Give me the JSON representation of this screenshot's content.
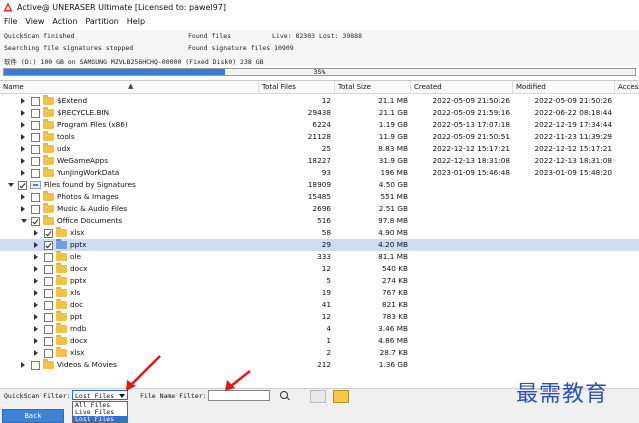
{
  "window": {
    "title": "Active@ UNERASER Ultimate [Licensed to: pawel97]"
  },
  "menu": [
    "File",
    "View",
    "Action",
    "Partition",
    "Help"
  ],
  "status": {
    "line1": "QuickScan finished",
    "line2": "Searching file signatures stopped",
    "line3": "Found files",
    "line4": "Found signature files  10909",
    "line5": "Live: 82303 Lost: 39888",
    "line6": "软件 (D:) 100 GB on SAMSUNG MZVLB256HCHQ-00000 (Fixed Disk0) 238 GB"
  },
  "progress": {
    "value": 35,
    "label": "35%"
  },
  "columns": {
    "name": "Name",
    "total_files": "Total Files",
    "total_size": "Total Size",
    "created": "Created",
    "modified": "Modified",
    "accessed": "Access"
  },
  "rows": [
    {
      "name": "$Extend",
      "files": "12",
      "size": "21.1 MB",
      "created": "2022-05-09 21:50:26",
      "modified": "2022-05-09 21:50:26"
    },
    {
      "name": "$RECYCLE.BIN",
      "files": "29438",
      "size": "21.1 GB",
      "created": "2022-05-09 21:59:16",
      "modified": "2022-06-22 08:18:44"
    },
    {
      "name": "Program Files (x86)",
      "files": "6224",
      "size": "1.19 GB",
      "created": "2022-05-13 17:07:18",
      "modified": "2022-12-19 17:34:44"
    },
    {
      "name": "tools",
      "files": "21128",
      "size": "11.9 GB",
      "created": "2022-05-09 21:50:51",
      "modified": "2022-11-23 11:39:29"
    },
    {
      "name": "udx",
      "files": "25",
      "size": "8.83 MB",
      "created": "2022-12-12 15:17:21",
      "modified": "2022-12-12 15:17:21"
    },
    {
      "name": "WeGameApps",
      "files": "18227",
      "size": "31.9 GB",
      "created": "2022-12-13 18:31:08",
      "modified": "2022-12-13 18:31:08"
    },
    {
      "name": "YunJingWorkData",
      "files": "93",
      "size": "196 MB",
      "created": "2023-01-09 15:46:48",
      "modified": "2023-01-09 15:48:20"
    },
    {
      "name": "Files found by Signatures",
      "files": "18909",
      "size": "4.50 GB",
      "created": "",
      "modified": ""
    },
    {
      "name": "Photos & Images",
      "files": "15485",
      "size": "551 MB",
      "created": "",
      "modified": ""
    },
    {
      "name": "Music & Audio Files",
      "files": "2696",
      "size": "2.51 GB",
      "created": "",
      "modified": ""
    },
    {
      "name": "Office Documents",
      "files": "516",
      "size": "97.8 MB",
      "created": "",
      "modified": ""
    },
    {
      "name": "xlsx",
      "files": "58",
      "size": "4.90 MB",
      "created": "",
      "modified": ""
    },
    {
      "name": "pptx",
      "files": "29",
      "size": "4.20 MB",
      "created": "",
      "modified": ""
    },
    {
      "name": "ole",
      "files": "333",
      "size": "81.1 MB",
      "created": "",
      "modified": ""
    },
    {
      "name": "docx",
      "files": "12",
      "size": "540 KB",
      "created": "",
      "modified": ""
    },
    {
      "name": "pptx",
      "files": "5",
      "size": "274 KB",
      "created": "",
      "modified": ""
    },
    {
      "name": "xls",
      "files": "19",
      "size": "767 KB",
      "created": "",
      "modified": ""
    },
    {
      "name": "doc",
      "files": "41",
      "size": "821 KB",
      "created": "",
      "modified": ""
    },
    {
      "name": "ppt",
      "files": "12",
      "size": "783 KB",
      "created": "",
      "modified": ""
    },
    {
      "name": "mdb",
      "files": "4",
      "size": "3.46 MB",
      "created": "",
      "modified": ""
    },
    {
      "name": "docx",
      "files": "1",
      "size": "4.86 MB",
      "created": "",
      "modified": ""
    },
    {
      "name": "xlsx",
      "files": "2",
      "size": "28.7 KB",
      "created": "",
      "modified": ""
    },
    {
      "name": "Videos & Movies",
      "files": "212",
      "size": "1.36 GB",
      "created": "",
      "modified": ""
    }
  ],
  "filters": {
    "quickscan_label": "QuickScan Filter:",
    "quickscan_value": "Lost Files",
    "options": [
      "All Files",
      "Live Files",
      "Lost Files"
    ],
    "filename_label": "File Name Filter:",
    "filename_value": ""
  },
  "back_label": "Back",
  "watermark": "最需教育",
  "colors": {
    "accent": "#2f6fd6",
    "selection": "#cfdcf0",
    "arrow": "#e01818"
  }
}
